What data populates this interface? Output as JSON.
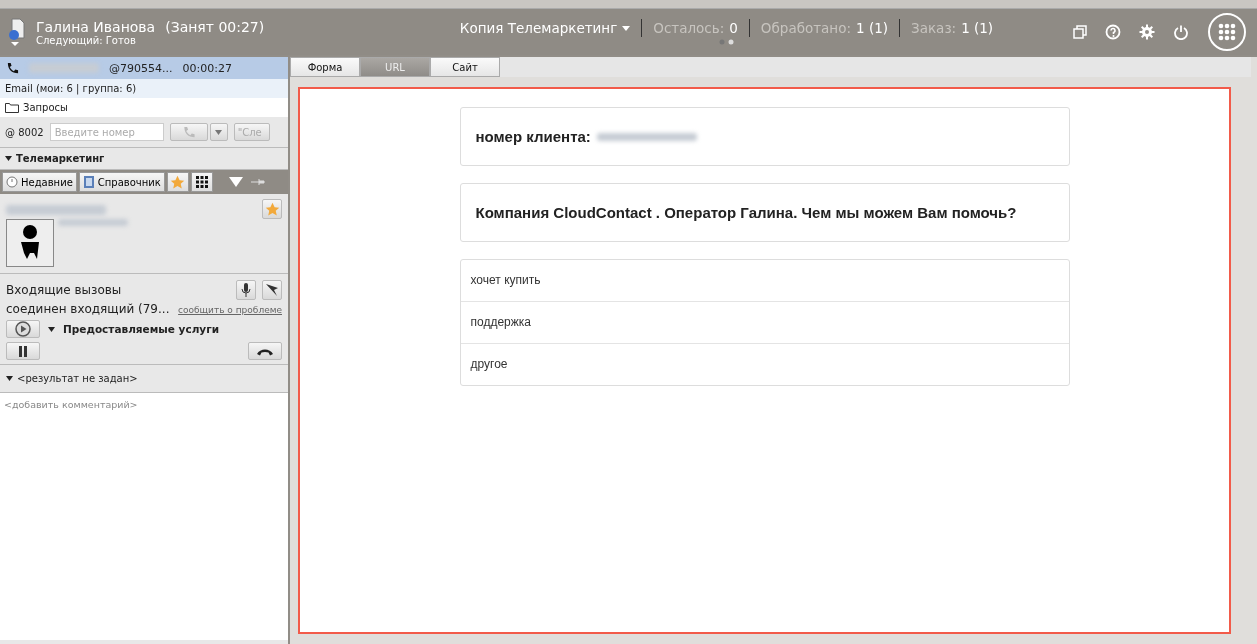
{
  "header": {
    "agent_name": "Галина Иванова",
    "agent_status": "(Занят 00:27)",
    "next_status": "Следующий: Готов",
    "campaign": "Копия Телемаркетинг",
    "counters": [
      {
        "label": "Осталось:",
        "value": "0"
      },
      {
        "label": "Обработано:",
        "value": "1 (1)"
      },
      {
        "label": "Заказ:",
        "value": "1 (1)"
      }
    ]
  },
  "sidebar": {
    "call": {
      "address": "@790554...",
      "timer": "00:00:27"
    },
    "email": "Email (мои: 6 | группа: 6)",
    "folder": "Запросы",
    "dial": {
      "extension": "@ 8002",
      "placeholder": "Введите номер",
      "transfer": "\"Сле"
    },
    "section": "Телемаркетинг",
    "tabs": [
      {
        "label": "Недавние",
        "selected": false
      },
      {
        "label": "Справочник",
        "selected": false
      }
    ],
    "incoming": {
      "title": "Входящие вызовы",
      "status": "соединен входящий (79...",
      "report_link": "сообщить о проблеме",
      "services": "Предоставляемые услуги"
    },
    "result": "<результат не задан>",
    "comment_placeholder": "<добавить комментарий>"
  },
  "content_tabs": [
    {
      "label": "Форма",
      "selected": false
    },
    {
      "label": "URL",
      "selected": true
    },
    {
      "label": "Сайт",
      "selected": false
    }
  ],
  "form": {
    "client_label": "номер клиента:",
    "greeting": "Компания CloudContact . Оператор Галина. Чем мы можем Вам помочь?",
    "options": [
      "хочет купить",
      "поддержка",
      "другое"
    ]
  }
}
